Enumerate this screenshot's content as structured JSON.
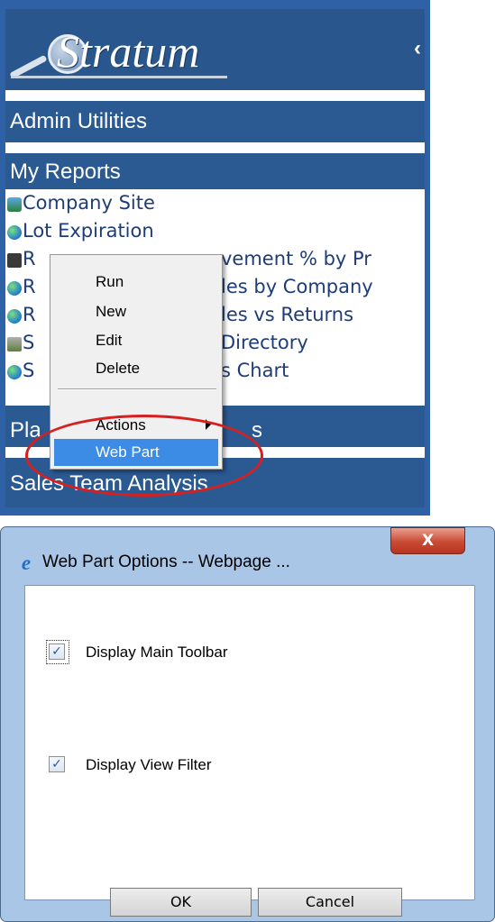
{
  "nav_panel": {
    "logo_text": "Stratum",
    "collapse_icon": "chevron-left-icon",
    "sections": {
      "admin_utilities": "Admin Utilities",
      "my_reports": "My Reports",
      "planner": "Pla",
      "planner_tail": "s",
      "sales_team": "Sales Team Analysis"
    },
    "reports": [
      {
        "label": "Company Site",
        "icon": "company-site-icon"
      },
      {
        "label": "Lot Expiration",
        "icon": "globe-icon"
      },
      {
        "label": "R",
        "visible_tail": "vement % by Pr",
        "icon": "report-icon"
      },
      {
        "label": "R",
        "visible_tail": "les by Company",
        "icon": "globe-icon"
      },
      {
        "label": "R",
        "visible_tail": "les vs Returns",
        "icon": "globe-icon"
      },
      {
        "label": "S",
        "visible_tail": "Directory",
        "icon": "directory-icon"
      },
      {
        "label": "S",
        "visible_tail": "s Chart",
        "icon": "globe-icon"
      }
    ]
  },
  "context_menu": {
    "items": [
      "Run",
      "New",
      "Edit",
      "Delete"
    ],
    "actions": "Actions",
    "web_part": "Web Part"
  },
  "dialog": {
    "title": "Web Part Options -- Webpage ...",
    "close_label": "X",
    "options": [
      {
        "label": "Display Main Toolbar",
        "checked": true
      },
      {
        "label": "Display View Filter",
        "checked": true
      }
    ],
    "ok_label": "OK",
    "cancel_label": "Cancel"
  },
  "colors": {
    "nav_blue": "#2b5a93",
    "link_blue": "#1e3d78",
    "highlight": "#3c8ce6",
    "annotation_red": "#d62020"
  }
}
